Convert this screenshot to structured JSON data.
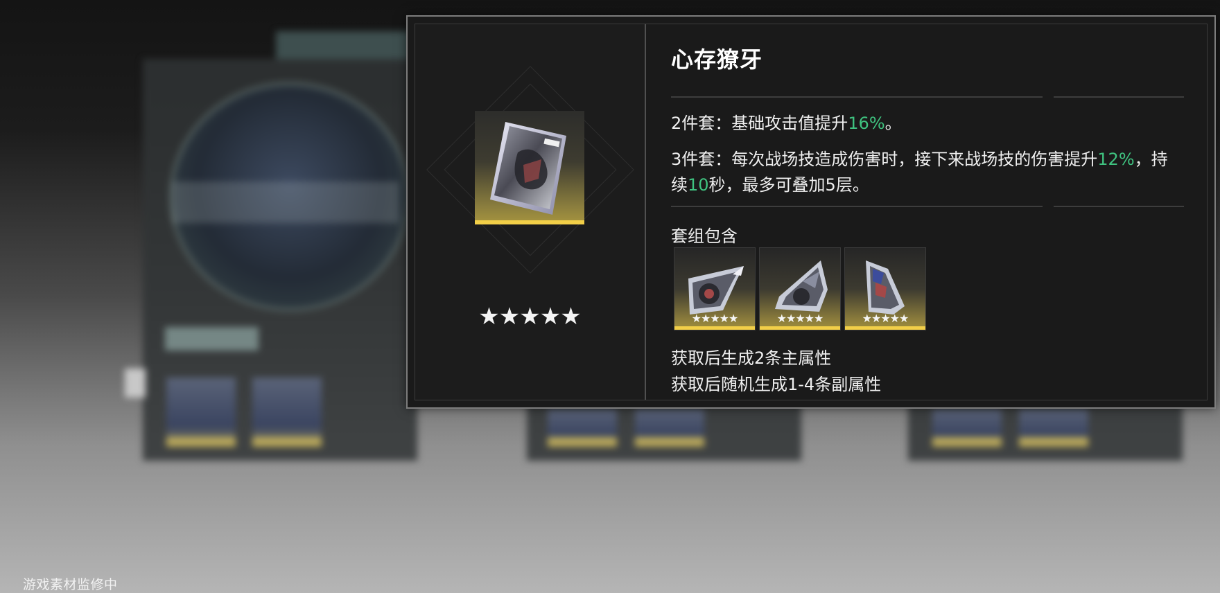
{
  "tooltip": {
    "set_name": "心存獠牙",
    "rarity_stars": "★★★★★",
    "bonus_2pc": {
      "prefix": "2件套：基础攻击值提升",
      "value": "16%",
      "suffix": "。"
    },
    "bonus_3pc": {
      "prefix": "3件套：每次战场技造成伤害时，接下来战场技的伤害提升",
      "value_1": "12%",
      "middle": "，持续",
      "value_2": "10",
      "suffix": "秒，最多可叠加5层。"
    },
    "contains_label": "套组包含",
    "pieces": [
      {
        "icon": "drive-disc-piece-1-icon",
        "stars": "★★★★★"
      },
      {
        "icon": "drive-disc-piece-2-icon",
        "stars": "★★★★★"
      },
      {
        "icon": "drive-disc-piece-3-icon",
        "stars": "★★★★★"
      }
    ],
    "main_stat_note": "获取后生成2条主属性",
    "sub_stat_note": "获取后随机生成1-4条副属性"
  },
  "footer": {
    "watermark": "游戏素材监修中"
  },
  "colors": {
    "highlight": "#3fc380",
    "rarity_gold": "#f2cf48",
    "popup_background": "#1a1a1a"
  }
}
